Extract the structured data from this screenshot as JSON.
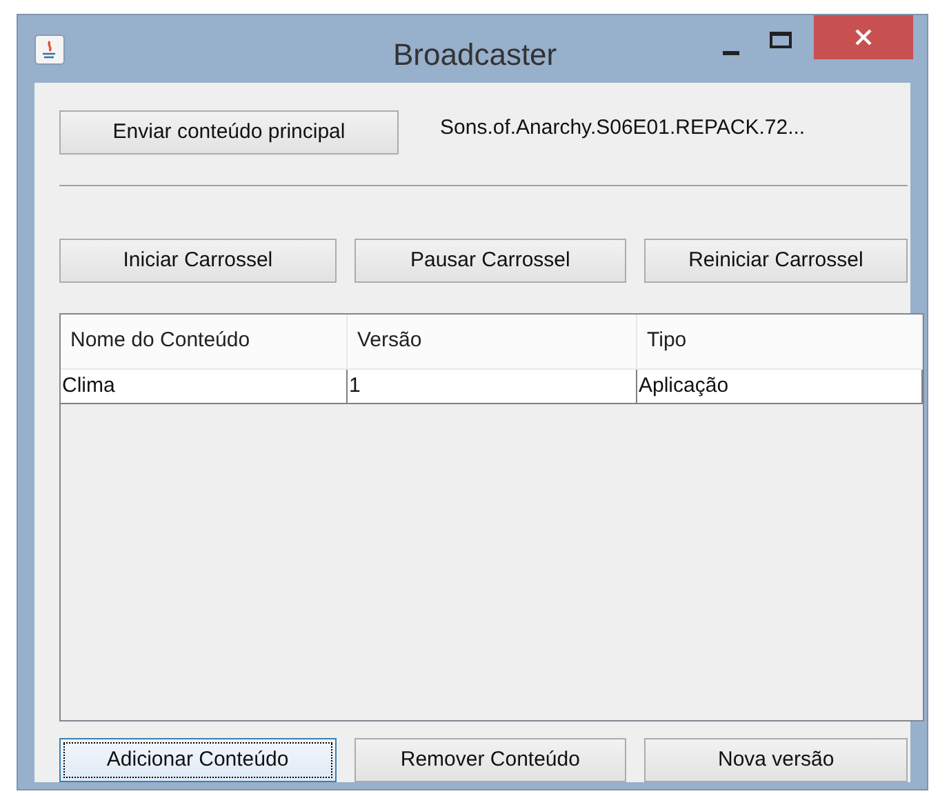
{
  "window": {
    "title": "Broadcaster"
  },
  "main_button": {
    "label": "Enviar conteúdo principal"
  },
  "file_label": "Sons.of.Anarchy.S06E01.REPACK.72...",
  "carousel_buttons": [
    {
      "label": "Iniciar Carrossel",
      "focused": false
    },
    {
      "label": "Pausar Carrossel",
      "focused": false
    },
    {
      "label": "Reiniciar Carrossel",
      "focused": false
    }
  ],
  "table": {
    "columns": [
      "Nome do Conteúdo",
      "Versão",
      "Tipo"
    ],
    "rows": [
      [
        "Clima",
        "1",
        "Aplicação"
      ]
    ]
  },
  "bottom_buttons": [
    {
      "label": "Adicionar Conteúdo",
      "focused": true
    },
    {
      "label": "Remover Conteúdo",
      "focused": false
    },
    {
      "label": "Nova versão",
      "focused": false
    }
  ]
}
